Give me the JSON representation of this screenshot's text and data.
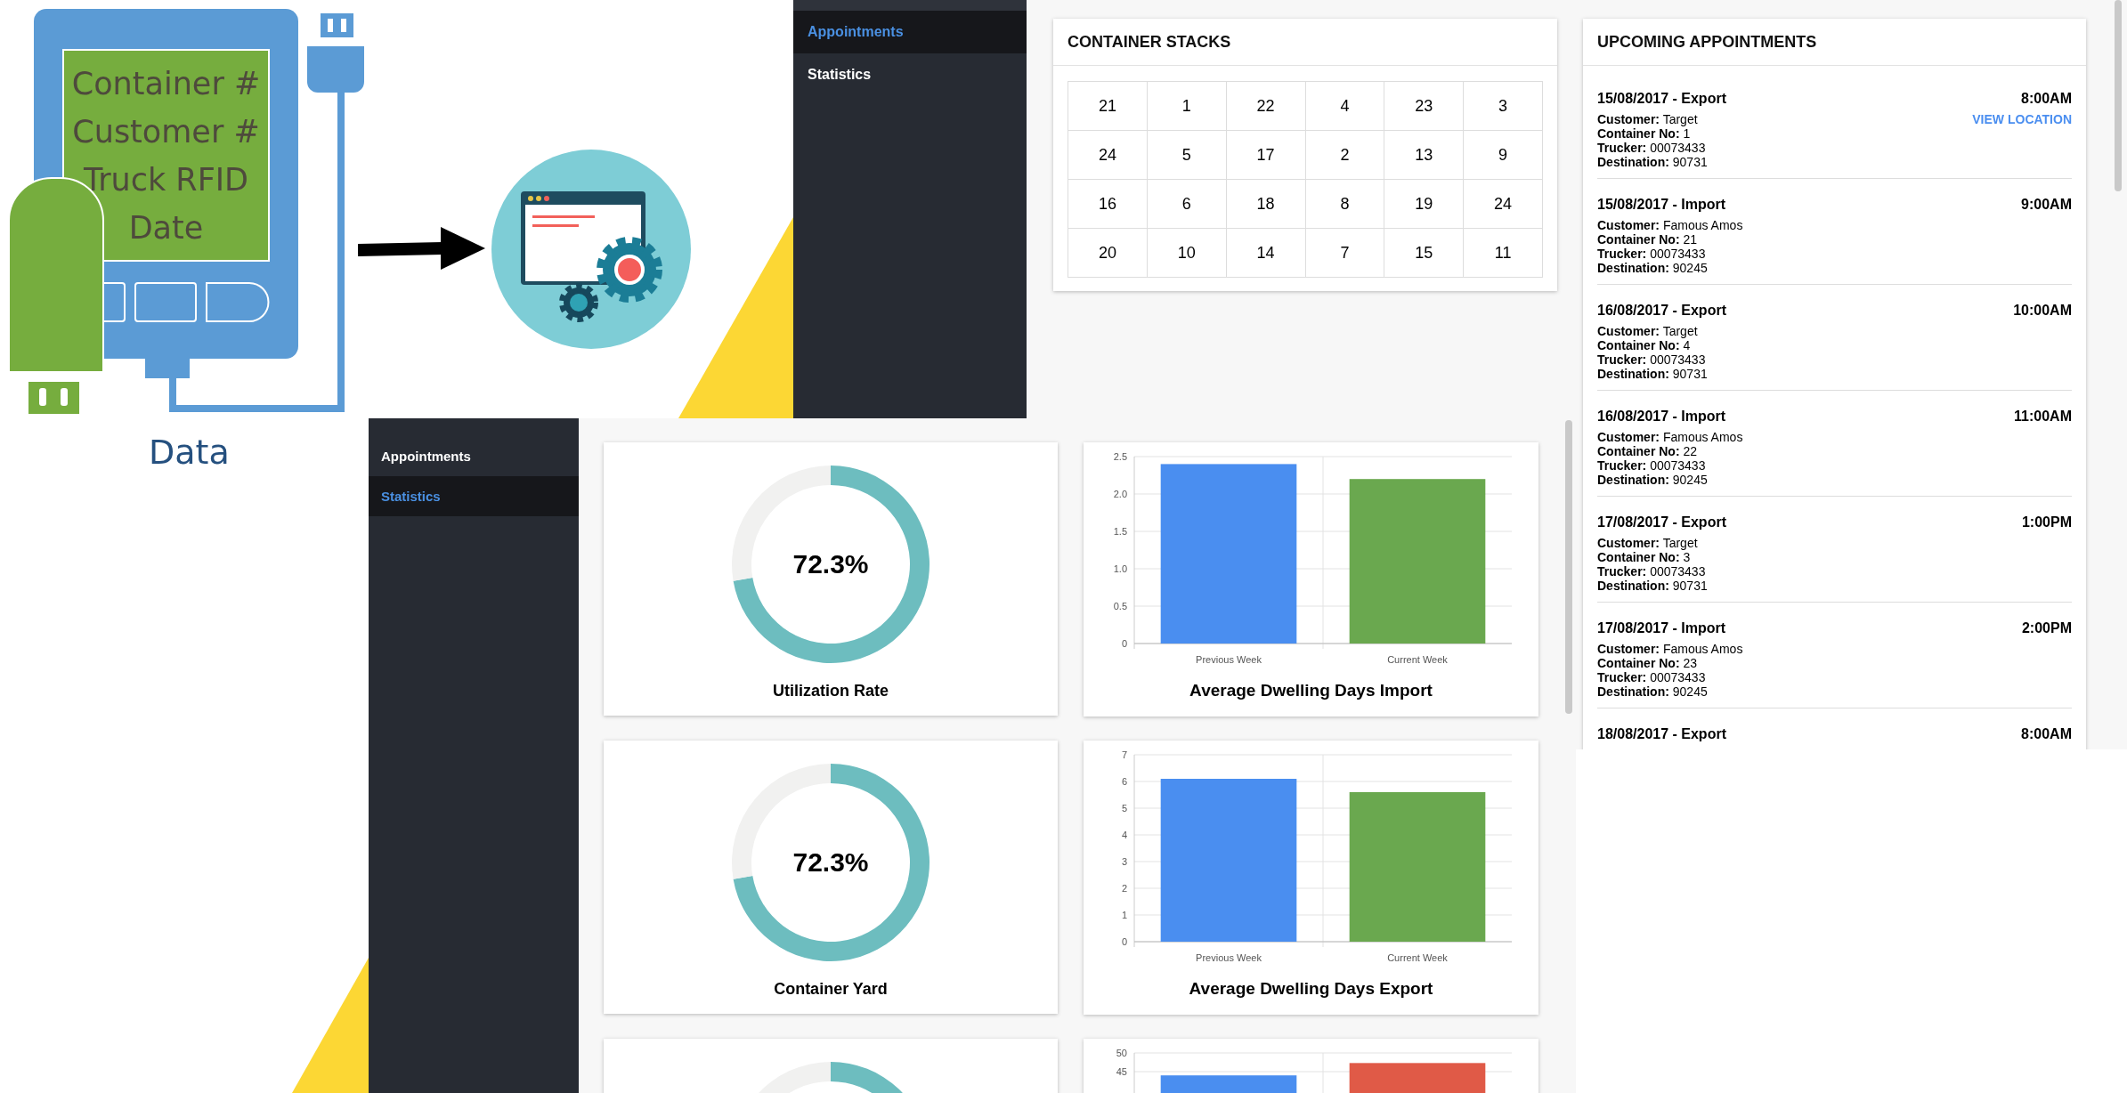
{
  "illustration": {
    "screen_lines": [
      "Container #",
      "Customer #",
      "Truck RFID",
      "Date"
    ],
    "caption": "Data"
  },
  "top_app": {
    "sidebar": [
      {
        "label": "Appointments",
        "selected": true
      },
      {
        "label": "Statistics",
        "selected": false
      }
    ],
    "stacks": {
      "title": "CONTAINER STACKS",
      "rows": [
        [
          "21",
          "1",
          "22",
          "4",
          "23",
          "3"
        ],
        [
          "24",
          "5",
          "17",
          "2",
          "13",
          "9"
        ],
        [
          "16",
          "6",
          "18",
          "8",
          "19",
          "24"
        ],
        [
          "20",
          "10",
          "14",
          "7",
          "15",
          "11"
        ]
      ]
    },
    "appointments": {
      "title": "UPCOMING APPOINTMENTS",
      "items": [
        {
          "heading": "15/08/2017 - Export",
          "time": "8:00AM",
          "link": "VIEW LOCATION",
          "lines": [
            "**Customer:** Target",
            "**Container No:** 1",
            "**Trucker:** 00073433",
            "**Destination:** 90731"
          ]
        },
        {
          "heading": "15/08/2017 - Import",
          "time": "9:00AM",
          "lines": [
            "**Customer:** Famous Amos",
            "**Container No:** 21",
            "**Trucker:** 00073433",
            "**Destination:** 90245"
          ]
        },
        {
          "heading": "16/08/2017 - Export",
          "time": "10:00AM",
          "lines": [
            "**Customer:** Target",
            "**Container No:** 4",
            "**Trucker:** 00073433",
            "**Destination:** 90731"
          ]
        },
        {
          "heading": "16/08/2017 - Import",
          "time": "11:00AM",
          "lines": [
            "**Customer:** Famous Amos",
            "**Container No:** 22",
            "**Trucker:** 00073433",
            "**Destination:** 90245"
          ]
        },
        {
          "heading": "17/08/2017 - Export",
          "time": "1:00PM",
          "lines": [
            "**Customer:** Target",
            "**Container No:** 3",
            "**Trucker:** 00073433",
            "**Destination:** 90731"
          ]
        },
        {
          "heading": "17/08/2017 - Import",
          "time": "2:00PM",
          "lines": [
            "**Customer:** Famous Amos",
            "**Container No:** 23",
            "**Trucker:** 00073433",
            "**Destination:** 90245"
          ]
        },
        {
          "heading": "18/08/2017 - Export",
          "time": "8:00AM"
        }
      ]
    }
  },
  "bottom_app": {
    "sidebar": [
      {
        "label": "Appointments",
        "selected": false
      },
      {
        "label": "Statistics",
        "selected": true
      }
    ],
    "rows": [
      {
        "donut": {
          "value_text": "72.3%",
          "label": "Utilization Rate",
          "chart_data": {
            "type": "donut",
            "values": [
              72.3,
              27.7
            ]
          }
        },
        "chart": {
          "title": "Average Dwelling Days Import",
          "chart_data": {
            "type": "bar",
            "grid": true,
            "categories": [
              "Previous Week",
              "Current Week"
            ],
            "series": [
              {
                "color": "#4a8ef0",
                "values": [
                  2.4,
                  null
                ]
              },
              {
                "color": "#6aa84f",
                "values": [
                  null,
                  2.2
                ]
              }
            ],
            "ylim": [
              0,
              2.5
            ],
            "yticks": [
              0,
              0.5,
              {
                "value": 1,
                "label": "1.0"
              },
              1.5,
              {
                "value": 2,
                "label": "2.0"
              },
              2.5
            ]
          }
        }
      },
      {
        "donut": {
          "value_text": "72.3%",
          "label": "Container Yard",
          "chart_data": {
            "type": "donut",
            "values": [
              72.3,
              27.7
            ]
          }
        },
        "chart": {
          "title": "Average Dwelling Days Export",
          "chart_data": {
            "type": "bar",
            "grid": true,
            "categories": [
              "Previous Week",
              "Current Week"
            ],
            "series": [
              {
                "color": "#4a8ef0",
                "values": [
                  6.1,
                  null
                ]
              },
              {
                "color": "#6aa84f",
                "values": [
                  null,
                  5.6
                ]
              }
            ],
            "ylim": [
              0,
              7
            ],
            "yticks": [
              0,
              1,
              2,
              3,
              4,
              5,
              6,
              7
            ]
          }
        }
      },
      {
        "donut": {
          "chart_data": {
            "type": "donut",
            "values": [
              72.3,
              27.7
            ]
          }
        },
        "chart": {
          "chart_data": {
            "type": "bar",
            "grid": true,
            "series": [
              {
                "color": "#4a8ef0",
                "values": [
                  44,
                  null
                ]
              },
              {
                "color": "#e05a47",
                "values": [
                  null,
                  47.3
                ]
              }
            ],
            "ylim": [
              0,
              50
            ],
            "yticks": [
              45,
              50
            ]
          }
        }
      }
    ]
  }
}
